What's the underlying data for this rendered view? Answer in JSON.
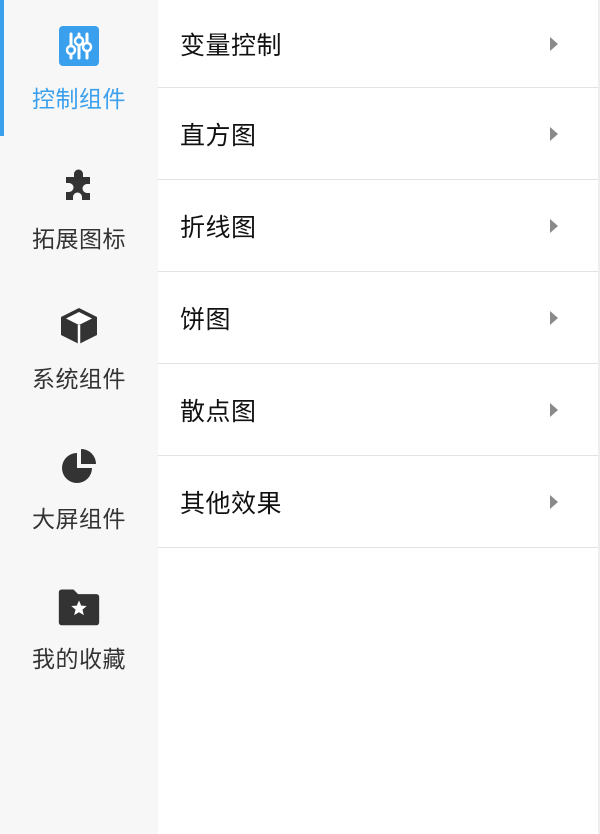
{
  "sidebar": {
    "accent_color": "#3aa0ee",
    "items": [
      {
        "label": "控制组件",
        "icon": "sliders-icon",
        "active": true
      },
      {
        "label": "拓展图标",
        "icon": "puzzle-icon",
        "active": false
      },
      {
        "label": "系统组件",
        "icon": "cube-icon",
        "active": false
      },
      {
        "label": "大屏组件",
        "icon": "pie-chart-icon",
        "active": false
      },
      {
        "label": "我的收藏",
        "icon": "star-folder-icon",
        "active": false
      }
    ]
  },
  "main": {
    "items": [
      {
        "label": "变量控制"
      },
      {
        "label": "直方图"
      },
      {
        "label": "折线图"
      },
      {
        "label": "饼图"
      },
      {
        "label": "散点图"
      },
      {
        "label": "其他效果"
      }
    ]
  }
}
